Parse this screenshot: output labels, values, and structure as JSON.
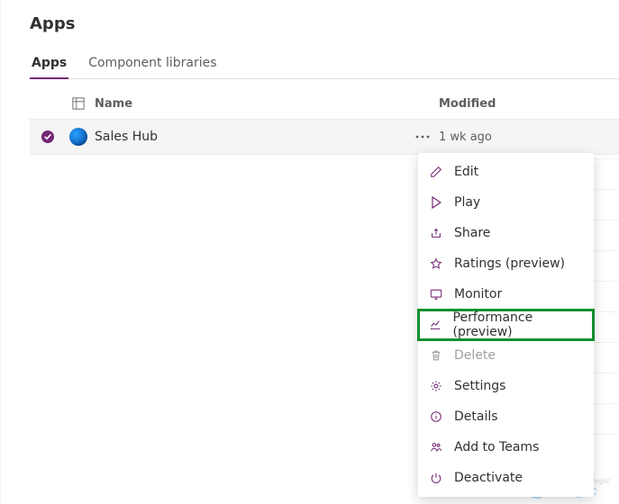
{
  "header": {
    "title": "Apps"
  },
  "tabs": {
    "apps": "Apps",
    "libraries": "Component libraries"
  },
  "columns": {
    "name": "Name",
    "modified": "Modified"
  },
  "row": {
    "name": "Sales Hub",
    "modified": "1 wk ago"
  },
  "menu": {
    "edit": "Edit",
    "play": "Play",
    "share": "Share",
    "ratings": "Ratings (preview)",
    "monitor": "Monitor",
    "performance": "Performance (preview)",
    "delete": "Delete",
    "settings": "Settings",
    "details": "Details",
    "teams": "Add to Teams",
    "deactivate": "Deactivate"
  },
  "watermark": {
    "brand": "inogic",
    "tag": "Innovative logic"
  }
}
